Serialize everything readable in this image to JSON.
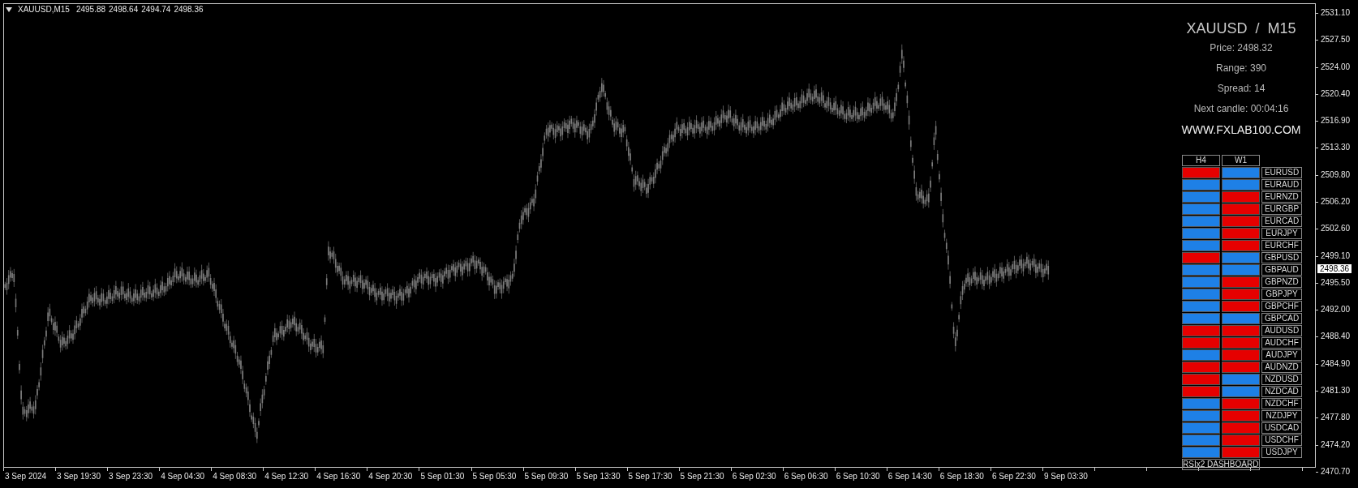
{
  "header": {
    "symbol": "XAUUSD,M15",
    "ohlc": [
      "2495.88",
      "2498.64",
      "2494.74",
      "2498.36"
    ]
  },
  "info": {
    "title": "XAUUSD  /  M15",
    "lines": [
      "Price: 2498.32",
      "Range: 390",
      "Spread: 14",
      "Next candle: 00:04:16"
    ],
    "website": "WWW.FXLAB100.COM"
  },
  "dashboard": {
    "columns": [
      "H4",
      "W1"
    ],
    "rows": [
      {
        "symbol": "EURUSD",
        "cells": [
          {
            "color": "#e60000"
          },
          {
            "color": "#1e80e6"
          }
        ]
      },
      {
        "symbol": "EURAUD",
        "cells": [
          {
            "color": "#1e80e6"
          },
          {
            "color": "#1e80e6"
          }
        ]
      },
      {
        "symbol": "EURNZD",
        "cells": [
          {
            "color": "#1e80e6"
          },
          {
            "color": "#e60000"
          }
        ]
      },
      {
        "symbol": "EURGBP",
        "cells": [
          {
            "color": "#1e80e6"
          },
          {
            "color": "#e60000"
          }
        ]
      },
      {
        "symbol": "EURCAD",
        "cells": [
          {
            "color": "#1e80e6"
          },
          {
            "color": "#e60000"
          }
        ]
      },
      {
        "symbol": "EURJPY",
        "cells": [
          {
            "color": "#1e80e6"
          },
          {
            "color": "#e60000"
          }
        ]
      },
      {
        "symbol": "EURCHF",
        "cells": [
          {
            "color": "#1e80e6"
          },
          {
            "color": "#e60000"
          }
        ]
      },
      {
        "symbol": "GBPUSD",
        "cells": [
          {
            "color": "#e60000"
          },
          {
            "color": "#1e80e6"
          }
        ]
      },
      {
        "symbol": "GBPAUD",
        "cells": [
          {
            "color": "#1e80e6"
          },
          {
            "color": "#1e80e6"
          }
        ]
      },
      {
        "symbol": "GBPNZD",
        "cells": [
          {
            "color": "#1e80e6"
          },
          {
            "color": "#e60000"
          }
        ]
      },
      {
        "symbol": "GBPJPY",
        "cells": [
          {
            "color": "#1e80e6"
          },
          {
            "color": "#e60000"
          }
        ]
      },
      {
        "symbol": "GBPCHF",
        "cells": [
          {
            "color": "#1e80e6"
          },
          {
            "color": "#e60000"
          }
        ]
      },
      {
        "symbol": "GBPCAD",
        "cells": [
          {
            "color": "#1e80e6"
          },
          {
            "color": "#1e80e6"
          }
        ]
      },
      {
        "symbol": "AUDUSD",
        "cells": [
          {
            "color": "#e60000"
          },
          {
            "color": "#e60000"
          }
        ]
      },
      {
        "symbol": "AUDCHF",
        "cells": [
          {
            "color": "#e60000"
          },
          {
            "color": "#e60000"
          }
        ]
      },
      {
        "symbol": "AUDJPY",
        "cells": [
          {
            "color": "#1e80e6"
          },
          {
            "color": "#e60000"
          }
        ]
      },
      {
        "symbol": "AUDNZD",
        "cells": [
          {
            "color": "#e60000"
          },
          {
            "color": "#e60000"
          }
        ]
      },
      {
        "symbol": "NZDUSD",
        "cells": [
          {
            "color": "#e60000"
          },
          {
            "color": "#1e80e6"
          }
        ]
      },
      {
        "symbol": "NZDCAD",
        "cells": [
          {
            "color": "#e60000"
          },
          {
            "color": "#1e80e6"
          }
        ]
      },
      {
        "symbol": "NZDCHF",
        "cells": [
          {
            "color": "#1e80e6"
          },
          {
            "color": "#e60000"
          }
        ]
      },
      {
        "symbol": "NZDJPY",
        "cells": [
          {
            "color": "#1e80e6"
          },
          {
            "color": "#e60000"
          }
        ]
      },
      {
        "symbol": "USDCAD",
        "cells": [
          {
            "color": "#1e80e6"
          },
          {
            "color": "#e60000"
          }
        ]
      },
      {
        "symbol": "USDCHF",
        "cells": [
          {
            "color": "#1e80e6"
          },
          {
            "color": "#e60000"
          }
        ]
      },
      {
        "symbol": "USDJPY",
        "cells": [
          {
            "color": "#1e80e6"
          },
          {
            "color": "#e60000"
          }
        ]
      }
    ],
    "footer": "RSIx2 DASHBOARD"
  },
  "price_axis": {
    "ticks": [
      "2531.10",
      "2527.50",
      "2524.00",
      "2520.40",
      "2516.90",
      "2513.30",
      "2509.80",
      "2506.20",
      "2502.60",
      "2499.10",
      "2495.50",
      "2492.00",
      "2488.40",
      "2484.90",
      "2481.30",
      "2477.80",
      "2474.20",
      "2470.70"
    ],
    "current_price": "2498.36"
  },
  "time_axis": {
    "ticks": [
      "3 Sep 2024",
      "3 Sep 19:30",
      "3 Sep 23:30",
      "4 Sep 04:30",
      "4 Sep 08:30",
      "4 Sep 12:30",
      "4 Sep 16:30",
      "4 Sep 20:30",
      "5 Sep 01:30",
      "5 Sep 05:30",
      "5 Sep 09:30",
      "5 Sep 13:30",
      "5 Sep 17:30",
      "5 Sep 21:30",
      "6 Sep 02:30",
      "6 Sep 06:30",
      "6 Sep 10:30",
      "6 Sep 14:30",
      "6 Sep 18:30",
      "6 Sep 22:30",
      "9 Sep 03:30"
    ]
  }
}
